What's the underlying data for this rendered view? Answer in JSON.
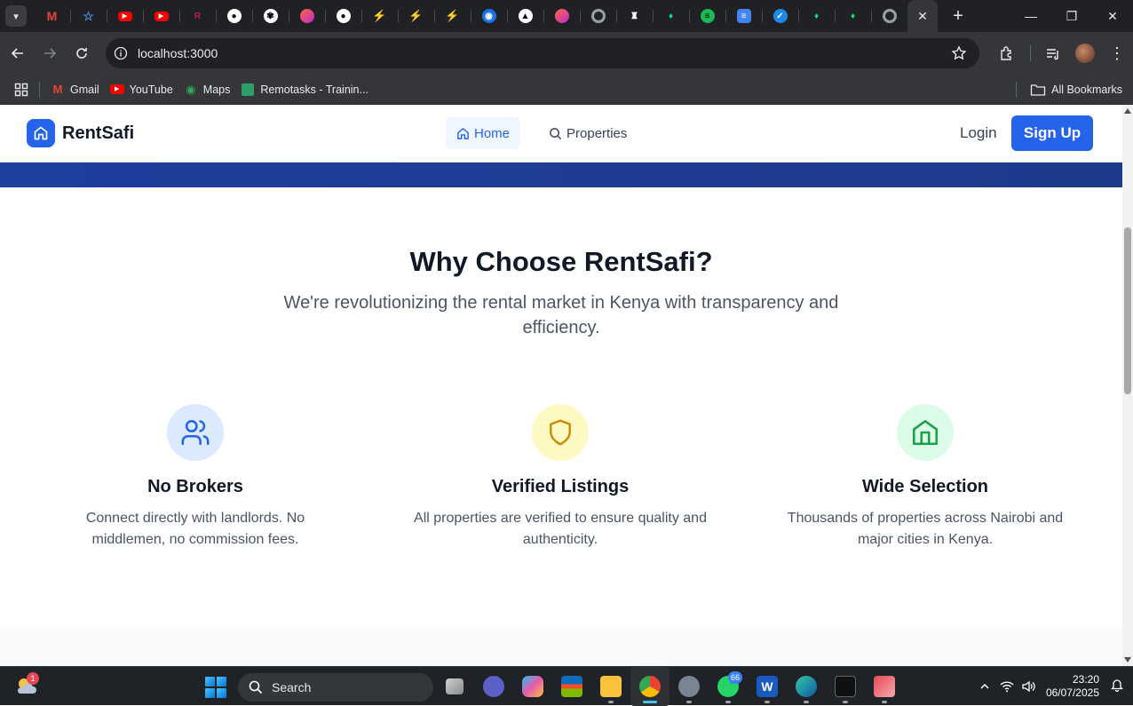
{
  "browser": {
    "url": "localhost:3000",
    "bookmarks": [
      {
        "label": "Gmail",
        "icon": "gmail-icon"
      },
      {
        "label": "YouTube",
        "icon": "youtube-icon"
      },
      {
        "label": "Maps",
        "icon": "maps-icon"
      },
      {
        "label": "Remotasks - Trainin...",
        "icon": "remotasks-icon"
      }
    ],
    "all_bookmarks": "All Bookmarks",
    "tab_favicons": [
      "gmail",
      "tasks-star",
      "youtube",
      "youtube",
      "remotasks",
      "github",
      "openai",
      "claude",
      "github",
      "bolt",
      "bolt",
      "bolt",
      "globe",
      "vercel",
      "claude",
      "chrome",
      "figma-robot",
      "leaf",
      "spotify",
      "docs",
      "tick",
      "leaf",
      "leaf",
      "chrome",
      "active-tab"
    ]
  },
  "site": {
    "brand": "RentSafi",
    "nav": {
      "home": "Home",
      "properties": "Properties"
    },
    "login": "Login",
    "signup": "Sign Up"
  },
  "why": {
    "title": "Why Choose RentSafi?",
    "subtitle": "We're revolutionizing the rental market in Kenya with transparency and efficiency.",
    "features": [
      {
        "title": "No Brokers",
        "desc": "Connect directly with landlords. No middlemen, no commission fees.",
        "icon": "users-icon",
        "color": "#2563eb",
        "bg": "#dbeafe"
      },
      {
        "title": "Verified Listings",
        "desc": "All properties are verified to ensure quality and authenticity.",
        "icon": "shield-icon",
        "color": "#ca8a04",
        "bg": "#fef9c3"
      },
      {
        "title": "Wide Selection",
        "desc": "Thousands of properties across Nairobi and major cities in Kenya.",
        "icon": "house-icon",
        "color": "#16a34a",
        "bg": "#dcfce7"
      }
    ]
  },
  "taskbar": {
    "search": "Search",
    "weather_badge": "1",
    "whatsapp_badge": "66",
    "time": "23:20",
    "date": "06/07/2025"
  }
}
